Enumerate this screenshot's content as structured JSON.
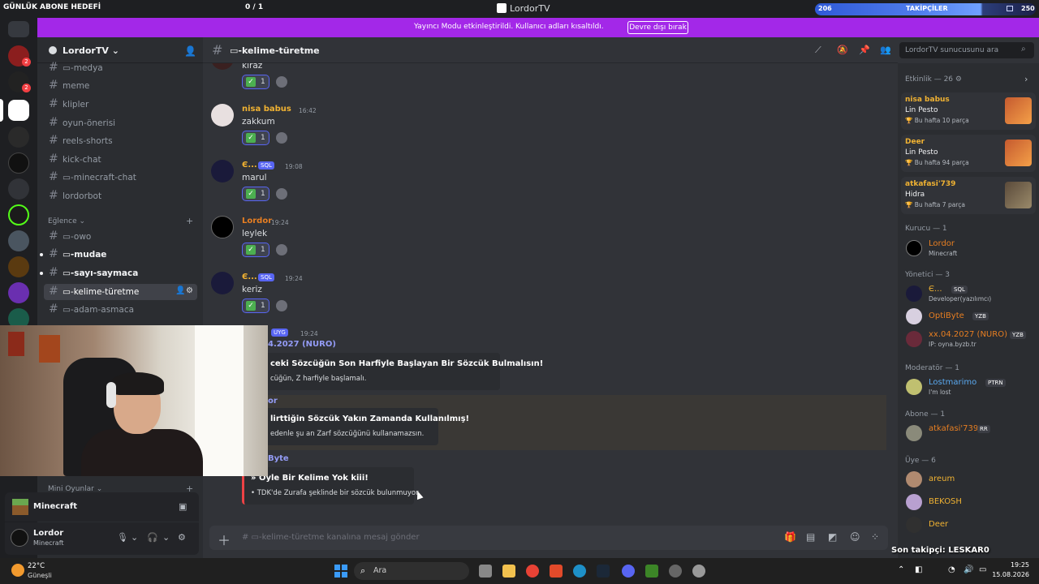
{
  "overlay": {
    "goal_label": "GÜNLÜK ABONE HEDEFİ",
    "goal_count": "0 / 1",
    "window_title": "LordorTV",
    "followers_left": "206",
    "followers_label": "TAKİPÇİLER",
    "followers_right": "250",
    "last_follower": "Son takipçi: LESKAR0"
  },
  "banner": {
    "text": "Yayıncı Modu etkinleştirildi. Kullanıcı adları kısaltıldı.",
    "button": "Devre dışı bırak"
  },
  "server": {
    "name": "LordorTV ⌄",
    "channels": [
      {
        "label": "▭-medya"
      },
      {
        "label": "meme"
      },
      {
        "label": "klipler"
      },
      {
        "label": "oyun-önerisi"
      },
      {
        "label": "reels-shorts"
      },
      {
        "label": "kick-chat"
      },
      {
        "label": "▭-minecraft-chat"
      },
      {
        "label": "lordorbot"
      }
    ],
    "category_eglence": "Eğlence ⌄",
    "channels2": [
      {
        "label": "▭-owo"
      },
      {
        "label": "▭-mudae"
      },
      {
        "label": "▭-sayı-saymaca"
      },
      {
        "label": "▭-kelime-türetme"
      },
      {
        "label": "▭-adam-asmaca"
      }
    ],
    "category_mini": "Mini Oyunlar ⌄"
  },
  "voice": {
    "game": "Minecraft",
    "user_name": "Lordor",
    "user_status": "Minecraft"
  },
  "chat": {
    "channel_title": "▭-kelime-türetme",
    "composer_placeholder": "# ▭-kelime-türetme kanalına mesaj gönder",
    "messages": [
      {
        "text": "kiraz",
        "count": "1"
      },
      {
        "user": "nisa babus",
        "time": "16:42",
        "text": "zakkum",
        "count": "1"
      },
      {
        "user": "Є...",
        "tag": "SQL",
        "time": "19:08",
        "text": "marul",
        "count": "1"
      },
      {
        "user": "Lordor",
        "time": "19:24",
        "text": "leylek",
        "count": "1"
      },
      {
        "user": "Є...",
        "tag": "SQL",
        "time": "19:24",
        "text": "keriz",
        "count": "1"
      },
      {
        "user": "4.2027 (NURO)",
        "tag": "UYG",
        "time": "19:24"
      }
    ],
    "embed1_title": "ceki Sözcüğün Son Harfiyle Başlayan Bir Sözcük Bulmalısın!",
    "embed1_desc": "cüğün, Z harfiyle başlamalı.",
    "embed2_user": "or",
    "embed2_title": "lirttiğin Sözcük Yakın Zamanda Kullanılmış!",
    "embed2_desc": "edenle şu an Zarf sözcüğünü kullanamazsın.",
    "embed3_user": "Byte",
    "embed3_title": "» Öyle Bir Kelime Yok kiii!",
    "embed3_desc": "• TDK'de Zurafa şeklinde bir sözcük bulunmuyor."
  },
  "search": {
    "placeholder": "LordorTV sunucusunu ara"
  },
  "members": {
    "activity_title": "Etkinlik — 26 ⚙",
    "activities": [
      {
        "user": "nisa babus",
        "game": "Lin Pesto",
        "sub": "🏆 Bu hafta 10 parça"
      },
      {
        "user": "Deer",
        "game": "Lin Pesto",
        "sub": "🏆 Bu hafta 94 parça"
      },
      {
        "user": "atkafasi'739",
        "game": "Hidra",
        "sub": "🏆 Bu hafta 7 parça"
      }
    ],
    "role_founder": "Kurucu — 1",
    "founder": {
      "name": "Lordor",
      "sub": "Minecraft"
    },
    "role_admin": "Yönetici — 3",
    "admins": [
      {
        "name": "Є...",
        "tag": "SQL",
        "sub": "Developer(yazılımcı)"
      },
      {
        "name": "OptiByte",
        "tag": "YZB",
        "sub": ""
      },
      {
        "name": "xx.04.2027 (NURO)",
        "tag": "YZB",
        "sub": "IP: oyna.byzb.tr"
      }
    ],
    "role_mod": "Moderatör — 1",
    "mod": {
      "name": "Lostmarimo",
      "tag": "PTRN",
      "sub": "I'm lost"
    },
    "role_sub": "Abone — 1",
    "subscriber": {
      "name": "atkafasi'739",
      "tag": "RR"
    },
    "role_member": "Üye — 6",
    "plain_members": [
      {
        "name": "areum"
      },
      {
        "name": "BEKOSH"
      },
      {
        "name": "Deer"
      }
    ]
  },
  "taskbar": {
    "temp": "22°C",
    "condition": "Güneşli",
    "search": "Ara",
    "time": "19:25",
    "date": "15.08.2026"
  },
  "colors": {
    "banner": "#a328e8",
    "accent": "#5865f2",
    "gold": "#f0b232",
    "orange_name": "#e67e22"
  }
}
